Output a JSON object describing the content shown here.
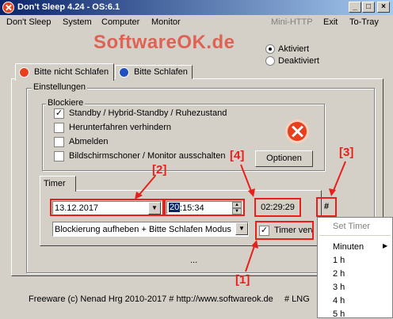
{
  "window": {
    "title": "Don't Sleep 4.24 - OS:6.1"
  },
  "menu": {
    "items": [
      "Don't Sleep",
      "System",
      "Computer",
      "Monitor"
    ],
    "mini_http": "Mini-HTTP",
    "exit": "Exit",
    "to_tray": "To-Tray"
  },
  "watermark": "SoftwareOK.de",
  "mode": {
    "aktiviert": "Aktiviert",
    "deaktiviert": "Deaktiviert"
  },
  "tabs": [
    "Bitte nicht Schlafen",
    "Bitte Schlafen"
  ],
  "settings": {
    "title": "Einstellungen",
    "blockiere_title": "Blockiere",
    "options": [
      {
        "label": "Standby / Hybrid-Standby / Ruhezustand",
        "checked": true
      },
      {
        "label": "Herunterfahren verhindern",
        "checked": false
      },
      {
        "label": "Abmelden",
        "checked": false
      },
      {
        "label": "Bildschirmschoner / Monitor ausschalten",
        "checked": false
      }
    ],
    "options_button": "Optionen"
  },
  "timer": {
    "tab": "Timer",
    "date": "13.12.2017",
    "time_sel": "20",
    "time_rest": ":15:34",
    "countdown": "02:29:29",
    "hash": "#",
    "mode": "Blockierung aufheben + Bitte Schlafen Modus",
    "use_label": "Timer verwenden",
    "use_checked": true
  },
  "annotations": {
    "a1": "[1]",
    "a2": "[2]",
    "a3": "[3]",
    "a4": "[4]"
  },
  "context_menu": {
    "set_timer": "Set Timer",
    "minuten": "Minuten",
    "items": [
      "1 h",
      "2 h",
      "3 h",
      "4 h",
      "5 h"
    ]
  },
  "ellipsis": "...",
  "footer": {
    "text": "Freeware (c) Nenad Hrg 2010-2017 # http://www.softwareok.de",
    "lng": "# LNG"
  },
  "colors": {
    "title_start": "#0a246a",
    "title_end": "#a6caf0",
    "accent_red": "#e8201c"
  }
}
